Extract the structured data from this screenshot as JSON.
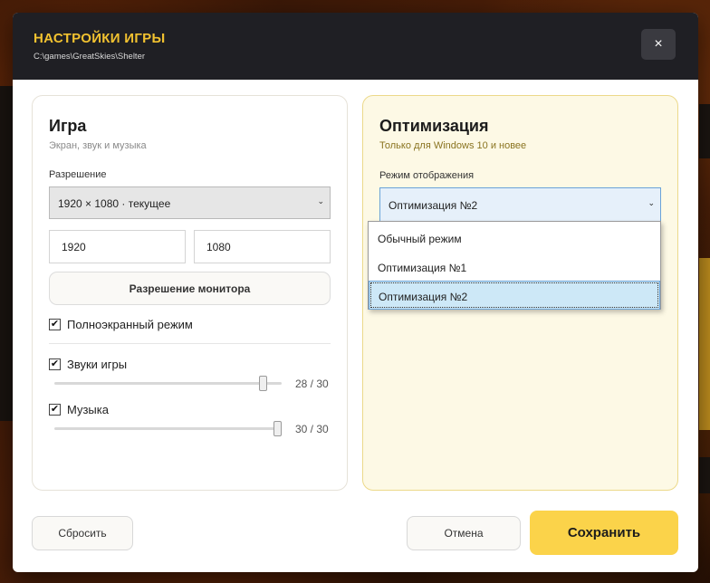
{
  "dialog": {
    "title": "НАСТРОЙКИ ИГРЫ",
    "path": "C:\\games\\GreatSkies\\Shelter",
    "close_label": "×"
  },
  "game_panel": {
    "title": "Игра",
    "subtitle": "Экран, звук и музыка",
    "resolution_label": "Разрешение",
    "resolution_value": "1920 × 1080 · текущее",
    "width_value": "1920",
    "height_value": "1080",
    "monitor_button": "Разрешение монитора",
    "fullscreen_label": "Полноэкранный режим",
    "fullscreen_checked": true,
    "sounds_label": "Звуки игры",
    "sounds_checked": true,
    "sounds_value": 28,
    "sounds_max": 30,
    "sounds_text": "28 / 30",
    "music_label": "Музыка",
    "music_checked": true,
    "music_value": 30,
    "music_max": 30,
    "music_text": "30 / 30"
  },
  "optimization_panel": {
    "title": "Оптимизация",
    "subtitle": "Только для Windows 10 и новее",
    "mode_label": "Режим отображения",
    "mode_value": "Оптимизация №2",
    "options": [
      "Обычный режим",
      "Оптимизация №1",
      "Оптимизация №2"
    ],
    "selected_index": 2
  },
  "footer": {
    "reset_label": "Сбросить",
    "cancel_label": "Отмена",
    "save_label": "Сохранить"
  },
  "icons": {
    "chevron": "chevron-down-icon",
    "check": "check-icon",
    "close": "close-icon"
  },
  "colors": {
    "accent": "#fbd34a",
    "title": "#f2c230",
    "header_bg": "#1f1f24",
    "select_focus": "#6aa3d8",
    "dropdown_selected": "#cde8f7"
  }
}
